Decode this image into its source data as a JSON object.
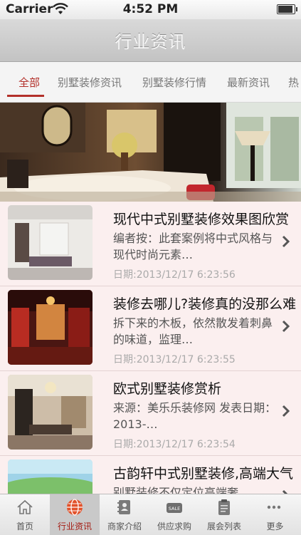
{
  "status_bar": {
    "carrier": "Carrier",
    "time": "4:52 PM",
    "battery_level": 0.95
  },
  "nav": {
    "title": "行业资讯"
  },
  "category_tabs": [
    {
      "label": "全部",
      "active": true
    },
    {
      "label": "别墅装修资讯",
      "active": false
    },
    {
      "label": "别墅装修行情",
      "active": false
    },
    {
      "label": "最新资讯",
      "active": false
    },
    {
      "label": "热",
      "active": false
    }
  ],
  "banner": {
    "image": "luxury-living-room-photo"
  },
  "articles": [
    {
      "title": "现代中式别墅装修效果图欣赏",
      "desc": "编者按：此套案例将中式风格与现代时尚元素…",
      "date": "日期:2013/12/17 6:23:56",
      "thumb": "white-room-photo"
    },
    {
      "title": "装修去哪儿?装修真的没那么难",
      "desc": "拆下来的木板，依然散发着刺鼻的味道，监理…",
      "date": "日期:2013/12/17 6:23:55",
      "thumb": "red-dining-room-photo"
    },
    {
      "title": "欧式别墅装修赏析",
      "desc": "来源：美乐乐装修网 发表日期：2013-…",
      "date": "日期:2013/12/17 6:23:54",
      "thumb": "classic-living-room-photo"
    },
    {
      "title": "古韵轩中式别墅装修,高端大气",
      "desc": "别墅装修不仅定位高端奢…",
      "date": "",
      "thumb": "garden-photo"
    }
  ],
  "tabbar": [
    {
      "label": "首页",
      "icon": "home-icon",
      "active": false
    },
    {
      "label": "行业资讯",
      "icon": "globe-icon",
      "active": true
    },
    {
      "label": "商家介绍",
      "icon": "contacts-icon",
      "active": false
    },
    {
      "label": "供应求购",
      "icon": "sale-tag-icon",
      "active": false,
      "icon_text": "SALE"
    },
    {
      "label": "展会列表",
      "icon": "clipboard-icon",
      "active": false
    },
    {
      "label": "更多",
      "icon": "more-icon",
      "active": false
    }
  ]
}
